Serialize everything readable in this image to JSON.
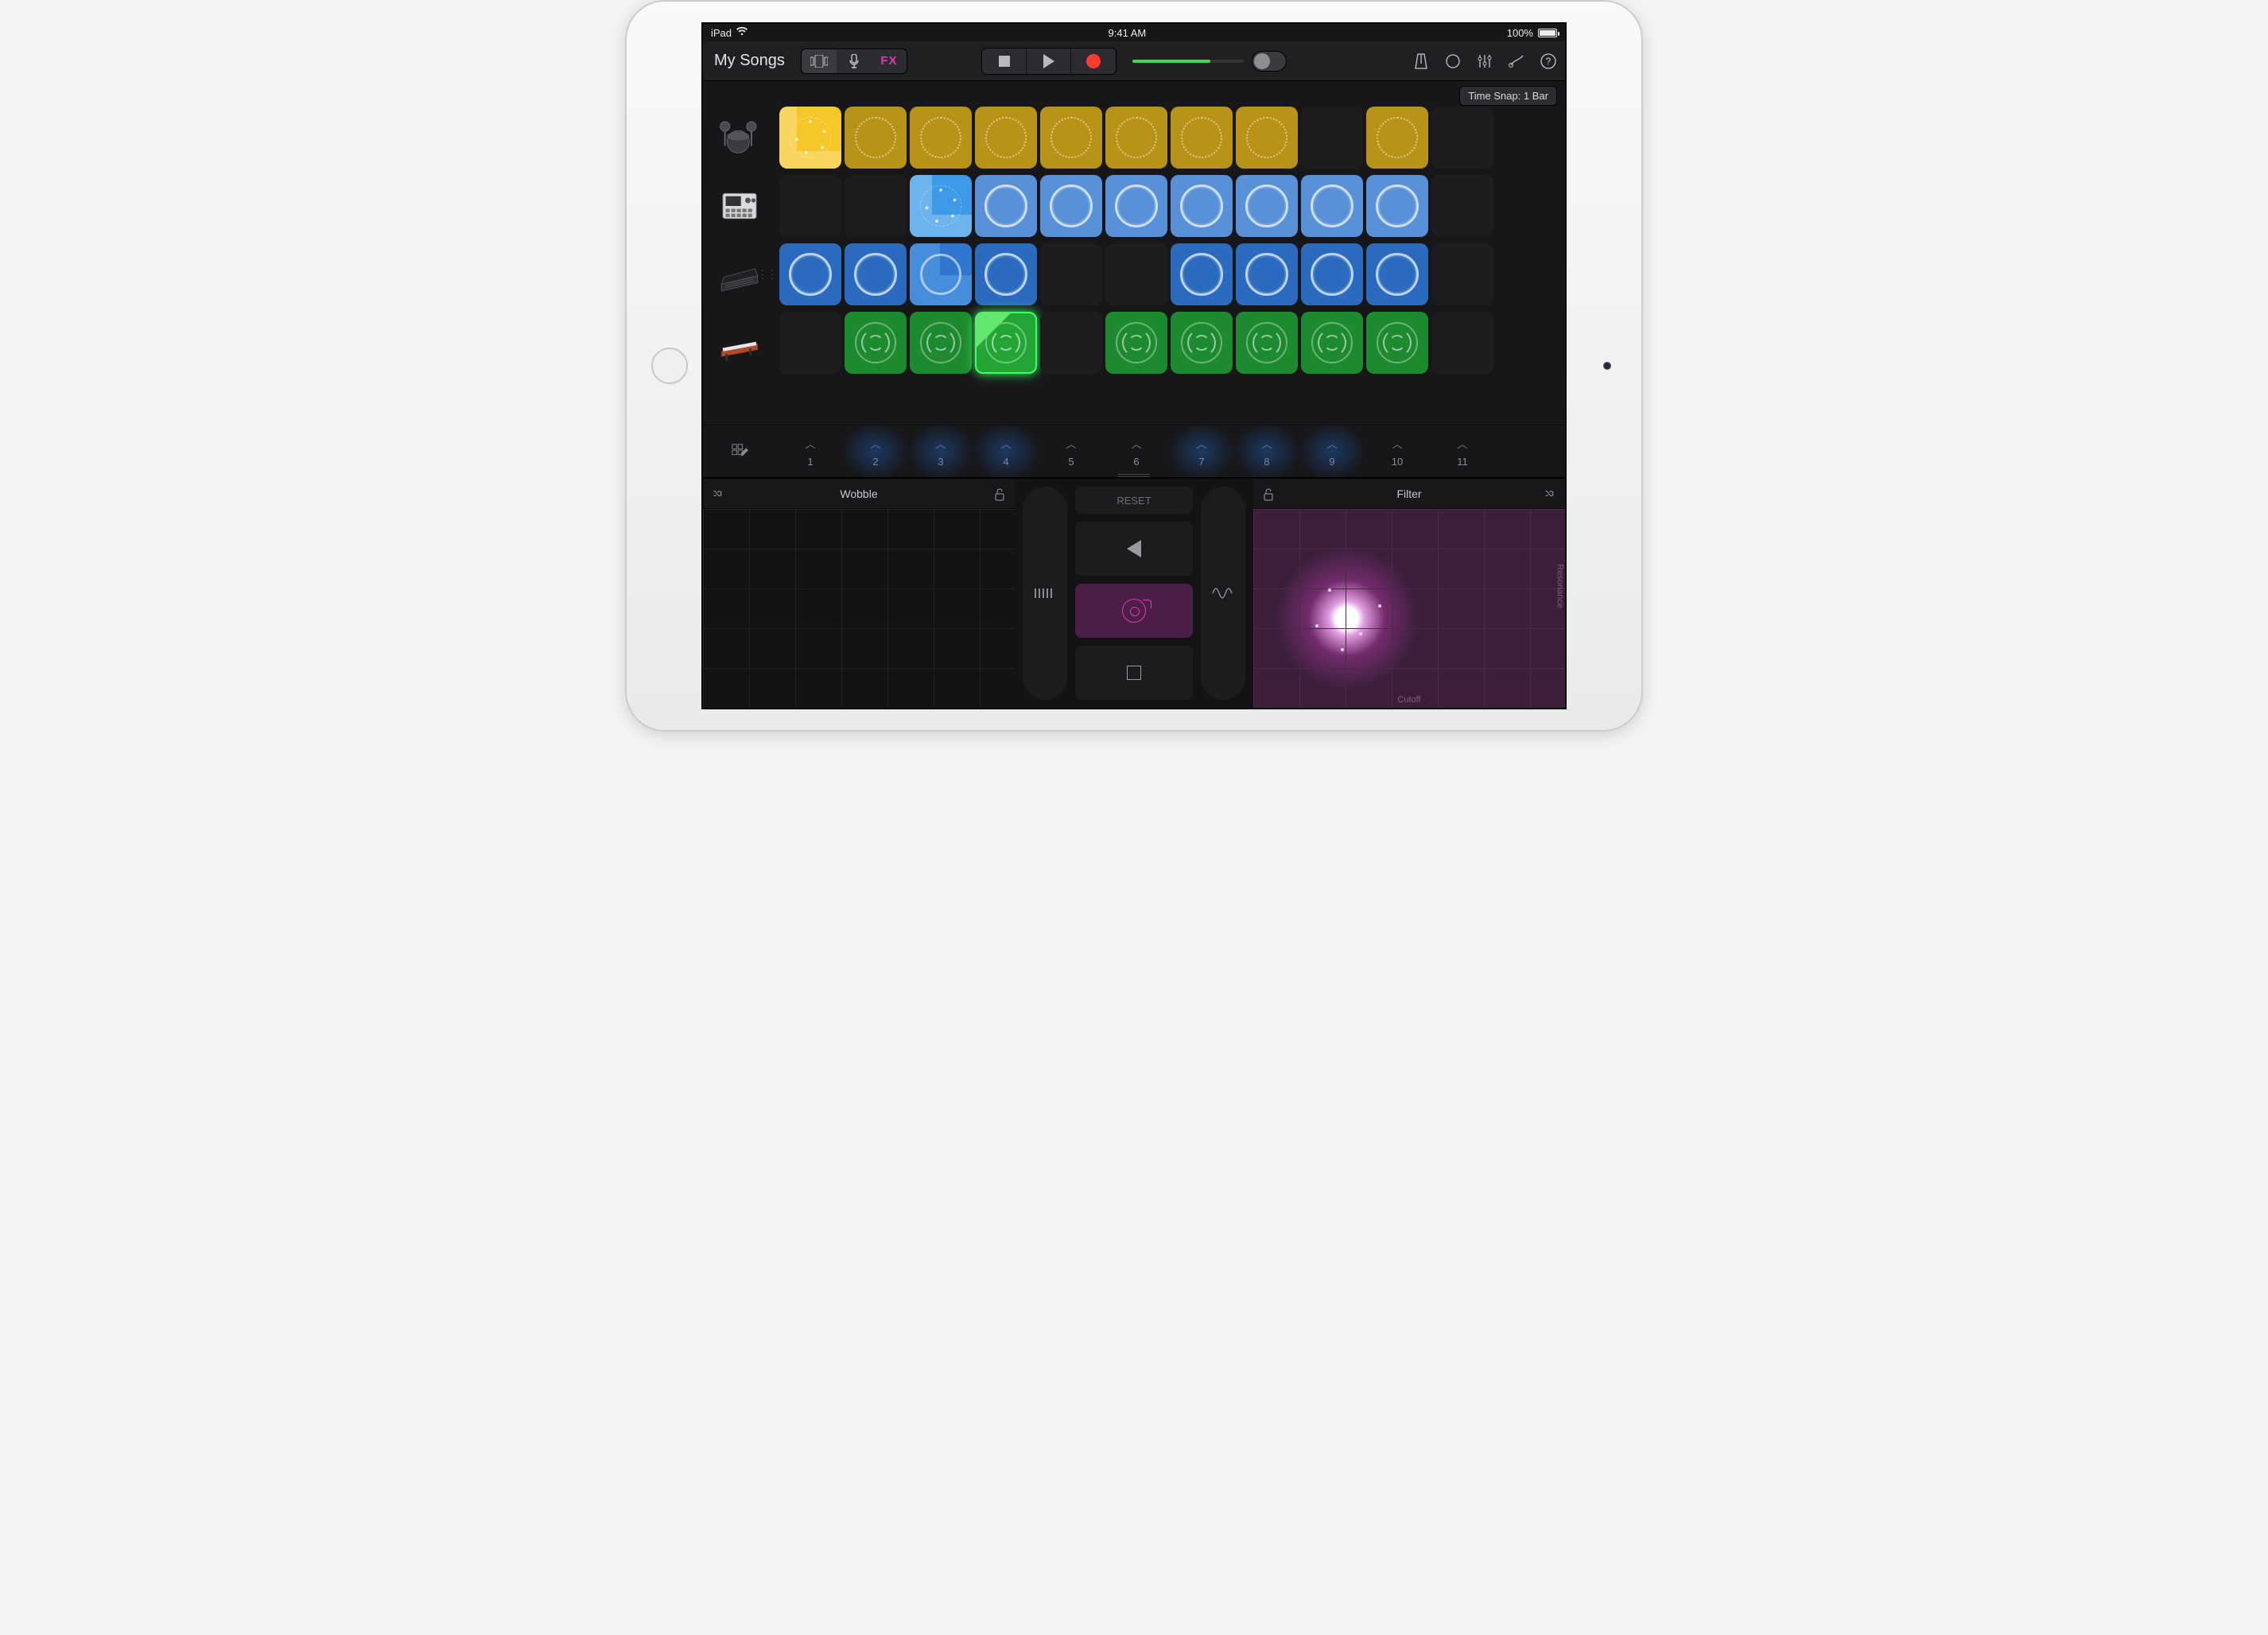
{
  "status": {
    "device": "iPad",
    "time": "9:41 AM",
    "battery_pct": "100%"
  },
  "toolbar": {
    "title": "My Songs",
    "fx_label": "FX"
  },
  "time_snap": "Time Snap: 1 Bar",
  "triggers": [
    "1",
    "2",
    "3",
    "4",
    "5",
    "6",
    "7",
    "8",
    "9",
    "10",
    "11"
  ],
  "trigger_glow": [
    1,
    2,
    3,
    6,
    7,
    8
  ],
  "rows": [
    {
      "track": "drums",
      "cells": [
        "yellow-active",
        "yellow",
        "yellow",
        "yellow",
        "yellow",
        "yellow",
        "yellow",
        "yellow",
        "empty",
        "yellow",
        "empty"
      ]
    },
    {
      "track": "drum-machine",
      "cells": [
        "empty",
        "empty",
        "lblue-active",
        "lblue",
        "lblue",
        "lblue",
        "lblue",
        "lblue",
        "lblue",
        "lblue",
        "empty"
      ]
    },
    {
      "track": "keyboard",
      "cells": [
        "blue",
        "blue",
        "blue-active",
        "blue",
        "empty",
        "empty",
        "blue",
        "blue",
        "blue",
        "blue",
        "empty"
      ]
    },
    {
      "track": "synth",
      "cells": [
        "empty",
        "green",
        "green",
        "green-active",
        "empty",
        "green",
        "green",
        "green",
        "green",
        "green",
        "empty"
      ]
    }
  ],
  "cell_shapes": {
    "yellow": "loop-ring",
    "yellow-active": "loop-dots",
    "lblue": "loop-wave",
    "lblue-active": "loop-dots",
    "blue": "loop-wave",
    "blue-active": "loop-ring thick",
    "green": "loop-arc",
    "green-active": "loop-arc"
  },
  "fx": {
    "left": {
      "name": "Wobble"
    },
    "right": {
      "name": "Filter",
      "x_axis": "Cutoff",
      "y_axis": "Resonance"
    },
    "reset_label": "RESET"
  }
}
